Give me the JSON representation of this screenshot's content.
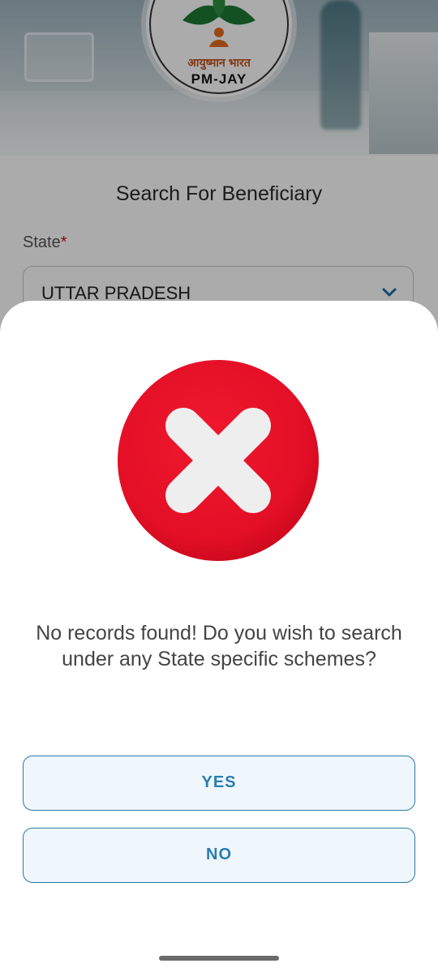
{
  "background_page": {
    "logo_hindi_text": "आयुष्मान भारत",
    "logo_brand": "PM-JAY",
    "title": "Search For Beneficiary",
    "state_label": "State",
    "required_marker": "*",
    "state_value": "UTTAR PRADESH"
  },
  "dialog": {
    "icon": "error-x-icon",
    "message": "No records found! Do you wish to search under any State specific schemes?",
    "yes_label": "YES",
    "no_label": "NO"
  },
  "colors": {
    "error_red": "#e8102a",
    "button_border": "#2a79a8",
    "button_text": "#2a7db0",
    "button_bg": "#eff7fd",
    "required_red": "#c0161c"
  }
}
